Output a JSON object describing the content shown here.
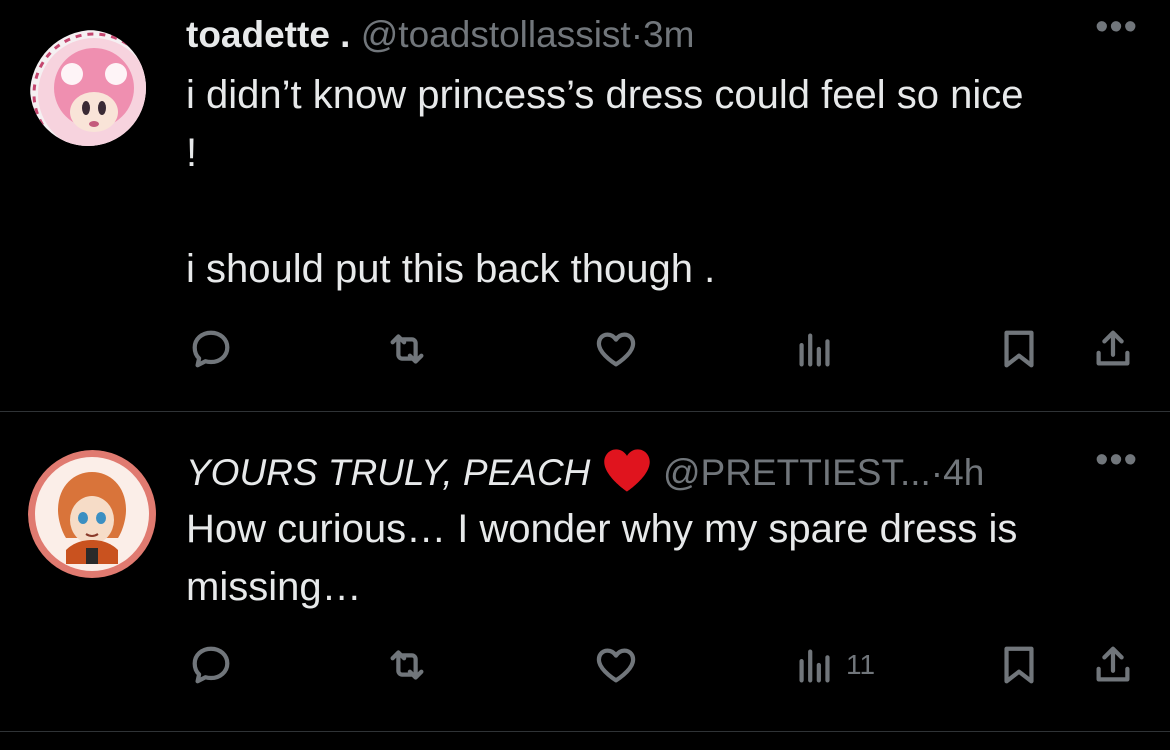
{
  "tweets": [
    {
      "display_name": "toadette .",
      "handle": "@toadstollassist",
      "separator": "·",
      "time": "3m",
      "more": "•••",
      "text": "i didn’t know princess’s dress could feel so nice\n!\n\ni should put this back though .",
      "avatar": "toadette-avatar",
      "actions": {
        "reply": "",
        "retweet": "",
        "like": "",
        "views": "",
        "bookmark": "",
        "share": ""
      }
    },
    {
      "display_name": "YOURS TRULY, PEACH",
      "name_emoji": "❤️",
      "handle": "@PRETTIEST...",
      "separator": "·",
      "time": "4h",
      "more": "•••",
      "text": "How curious… I wonder why my spare dress is\nmissing…",
      "avatar": "peach-avatar",
      "actions": {
        "reply": "",
        "retweet": "",
        "like": "",
        "views": "11",
        "bookmark": "",
        "share": ""
      }
    }
  ],
  "colors": {
    "background": "#000000",
    "text": "#e7e9ea",
    "muted": "#71767b",
    "divider": "#2f3336",
    "heart": "#e0141e"
  },
  "icons": [
    "reply-icon",
    "retweet-icon",
    "like-icon",
    "views-icon",
    "bookmark-icon",
    "share-icon",
    "more-icon"
  ]
}
